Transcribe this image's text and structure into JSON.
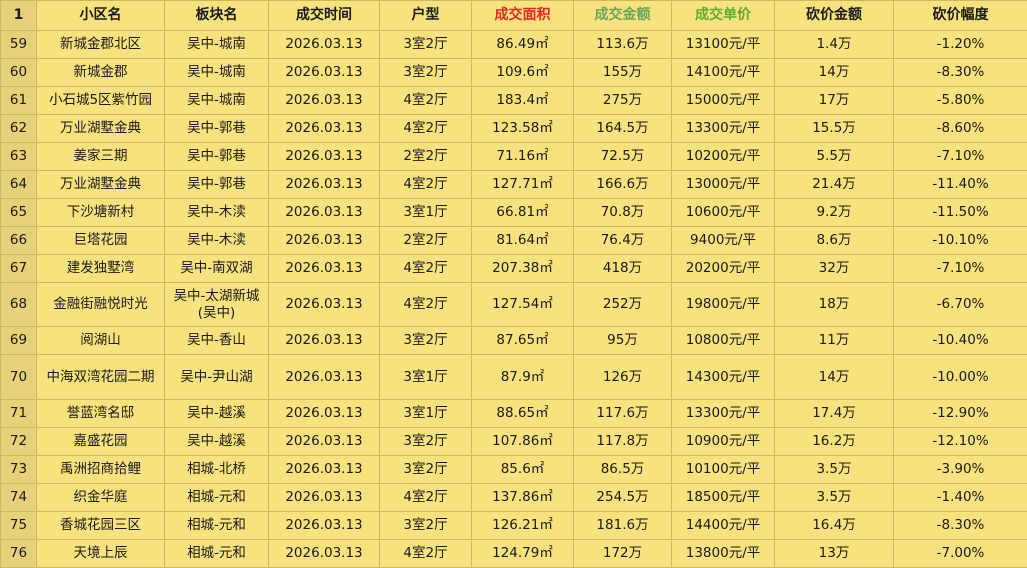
{
  "sheet": {
    "header_rownum": "1",
    "columns": {
      "name": "小区名",
      "block": "板块名",
      "date": "成交时间",
      "layout": "户型",
      "area": "成交面积",
      "total": "成交金额",
      "unit_price": "成交单价",
      "cut_amount": "砍价金额",
      "cut_pct": "砍价幅度"
    },
    "rows": [
      {
        "rownum": "59",
        "name": "新城金郡北区",
        "block": "吴中-城南",
        "date": "2026.03.13",
        "layout": "3室2厅",
        "area": "86.49㎡",
        "total": "113.6万",
        "unit_price": "13100元/平",
        "cut_amount": "1.4万",
        "cut_pct": "-1.20%"
      },
      {
        "rownum": "60",
        "name": "新城金郡",
        "block": "吴中-城南",
        "date": "2026.03.13",
        "layout": "3室2厅",
        "area": "109.6㎡",
        "total": "155万",
        "unit_price": "14100元/平",
        "cut_amount": "14万",
        "cut_pct": "-8.30%"
      },
      {
        "rownum": "61",
        "name": "小石城5区紫竹园",
        "block": "吴中-城南",
        "date": "2026.03.13",
        "layout": "4室2厅",
        "area": "183.4㎡",
        "total": "275万",
        "unit_price": "15000元/平",
        "cut_amount": "17万",
        "cut_pct": "-5.80%"
      },
      {
        "rownum": "62",
        "name": "万业湖墅金典",
        "block": "吴中-郭巷",
        "date": "2026.03.13",
        "layout": "4室2厅",
        "area": "123.58㎡",
        "total": "164.5万",
        "unit_price": "13300元/平",
        "cut_amount": "15.5万",
        "cut_pct": "-8.60%"
      },
      {
        "rownum": "63",
        "name": "姜家三期",
        "block": "吴中-郭巷",
        "date": "2026.03.13",
        "layout": "2室2厅",
        "area": "71.16㎡",
        "total": "72.5万",
        "unit_price": "10200元/平",
        "cut_amount": "5.5万",
        "cut_pct": "-7.10%"
      },
      {
        "rownum": "64",
        "name": "万业湖墅金典",
        "block": "吴中-郭巷",
        "date": "2026.03.13",
        "layout": "4室2厅",
        "area": "127.71㎡",
        "total": "166.6万",
        "unit_price": "13000元/平",
        "cut_amount": "21.4万",
        "cut_pct": "-11.40%"
      },
      {
        "rownum": "65",
        "name": "下沙塘新村",
        "block": "吴中-木渎",
        "date": "2026.03.13",
        "layout": "3室1厅",
        "area": "66.81㎡",
        "total": "70.8万",
        "unit_price": "10600元/平",
        "cut_amount": "9.2万",
        "cut_pct": "-11.50%"
      },
      {
        "rownum": "66",
        "name": "巨塔花园",
        "block": "吴中-木渎",
        "date": "2026.03.13",
        "layout": "2室2厅",
        "area": "81.64㎡",
        "total": "76.4万",
        "unit_price": "9400元/平",
        "cut_amount": "8.6万",
        "cut_pct": "-10.10%"
      },
      {
        "rownum": "67",
        "name": "建发独墅湾",
        "block": "吴中-南双湖",
        "date": "2026.03.13",
        "layout": "4室2厅",
        "area": "207.38㎡",
        "total": "418万",
        "unit_price": "20200元/平",
        "cut_amount": "32万",
        "cut_pct": "-7.10%"
      },
      {
        "rownum": "68",
        "name": "金融街融悦时光",
        "block": "吴中-太湖新城(吴中)",
        "date": "2026.03.13",
        "layout": "4室2厅",
        "area": "127.54㎡",
        "total": "252万",
        "unit_price": "19800元/平",
        "cut_amount": "18万",
        "cut_pct": "-6.70%"
      },
      {
        "rownum": "69",
        "name": "阅湖山",
        "block": "吴中-香山",
        "date": "2026.03.13",
        "layout": "3室2厅",
        "area": "87.65㎡",
        "total": "95万",
        "unit_price": "10800元/平",
        "cut_amount": "11万",
        "cut_pct": "-10.40%"
      },
      {
        "rownum": "70",
        "name": "中海双湾花园二期",
        "block": "吴中-尹山湖",
        "date": "2026.03.13",
        "layout": "3室1厅",
        "area": "87.9㎡",
        "total": "126万",
        "unit_price": "14300元/平",
        "cut_amount": "14万",
        "cut_pct": "-10.00%"
      },
      {
        "rownum": "71",
        "name": "誉蓝湾名邸",
        "block": "吴中-越溪",
        "date": "2026.03.13",
        "layout": "3室1厅",
        "area": "88.65㎡",
        "total": "117.6万",
        "unit_price": "13300元/平",
        "cut_amount": "17.4万",
        "cut_pct": "-12.90%"
      },
      {
        "rownum": "72",
        "name": "嘉盛花园",
        "block": "吴中-越溪",
        "date": "2026.03.13",
        "layout": "3室2厅",
        "area": "107.86㎡",
        "total": "117.8万",
        "unit_price": "10900元/平",
        "cut_amount": "16.2万",
        "cut_pct": "-12.10%"
      },
      {
        "rownum": "73",
        "name": "禹洲招商拾鲤",
        "block": "相城-北桥",
        "date": "2026.03.13",
        "layout": "3室2厅",
        "area": "85.6㎡",
        "total": "86.5万",
        "unit_price": "10100元/平",
        "cut_amount": "3.5万",
        "cut_pct": "-3.90%"
      },
      {
        "rownum": "74",
        "name": "织金华庭",
        "block": "相城-元和",
        "date": "2026.03.13",
        "layout": "4室2厅",
        "area": "137.86㎡",
        "total": "254.5万",
        "unit_price": "18500元/平",
        "cut_amount": "3.5万",
        "cut_pct": "-1.40%"
      },
      {
        "rownum": "75",
        "name": "香城花园三区",
        "block": "相城-元和",
        "date": "2026.03.13",
        "layout": "3室2厅",
        "area": "126.21㎡",
        "total": "181.6万",
        "unit_price": "14400元/平",
        "cut_amount": "16.4万",
        "cut_pct": "-8.30%"
      },
      {
        "rownum": "76",
        "name": "天境上辰",
        "block": "相城-元和",
        "date": "2026.03.13",
        "layout": "4室2厅",
        "area": "124.79㎡",
        "total": "172万",
        "unit_price": "13800元/平",
        "cut_amount": "13万",
        "cut_pct": "-7.00%"
      }
    ]
  },
  "colors": {
    "background": "#f7e27e",
    "area_text": "#e02828",
    "total_text": "#5e9c45",
    "unit_text": "#5fa63d"
  }
}
